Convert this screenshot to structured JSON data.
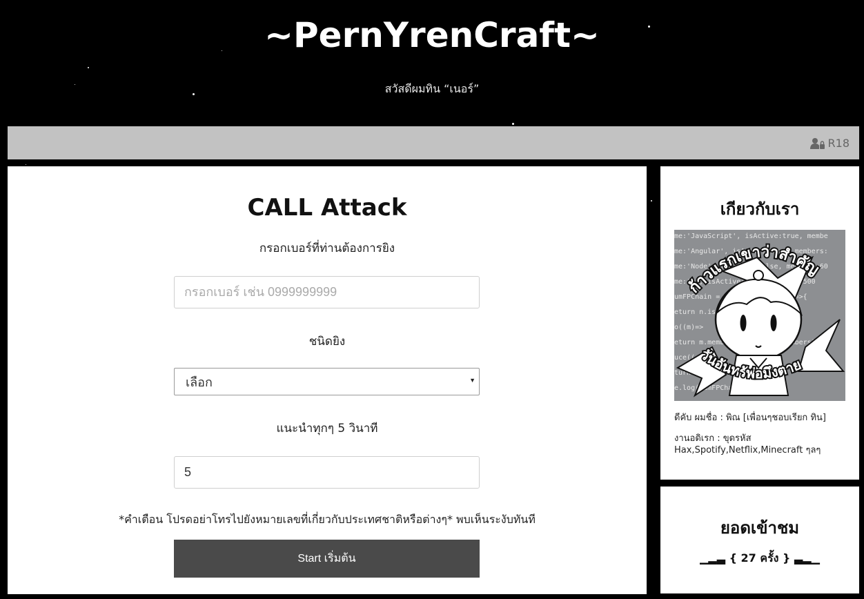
{
  "header": {
    "title": "~PernYrenCraft~",
    "subtitle": "สวัสดีผมทิน “เนอร์”"
  },
  "navbar": {
    "r18_label": "R18",
    "r18_icon": "user-lock-icon"
  },
  "attack_form": {
    "title": "CALL Attack",
    "phone_label": "กรอกเบอร์ที่ท่านต้องการยิง",
    "phone_placeholder": "กรอกเบอร์ เช่น 0999999999",
    "phone_value": "",
    "type_label": "ชนิดยิง",
    "type_selected": "เลือก",
    "interval_label": "แนะนำทุกๆ 5 วินาที",
    "interval_value": "5",
    "warning": "*คำเตือน โปรดอย่าโทรไปยังหมายเลขที่เกี่ยวกับประเทศชาติหรือต่างๆ* พบเห็นระงับทันที",
    "start_button": "Start เริ่มต้น"
  },
  "about": {
    "title": "เกียวกับเรา",
    "image_caption_top": "ก้าวแรกเขาว่าสำคัญ",
    "image_caption_bottom": "วันอันทรัพ่อมึงตาย",
    "code_lines": [
      "me:'JavaScript', isActive:true, membe",
      "me:'Angular', isActive:true, members:",
      "me:'Node', isActive:false, members:60",
      "me:'R', isActive:true, members:500",
      "umFPChain = teetup.filter((n)=>{",
      "eturn n.isActive;",
      "o((m)=>",
      "eturn m.members- (0.1 * m.members);",
      "uce((",
      "turn acc",
      "e.log(sumFPChain);"
    ],
    "line1": "ดีคับ ผมชื่อ : พิณ [เพื่อนๆชอบเรียก ทิน]",
    "line2": "งานอดิเรก : ขุดรหัส",
    "line3": "Hax,Spotify,Netflix,Minecraft ๆลๆ"
  },
  "visits": {
    "title": "ยอดเข้าชม",
    "count_text": "▁▂▃ { 27  ครั้ง } ▃▂▁"
  }
}
